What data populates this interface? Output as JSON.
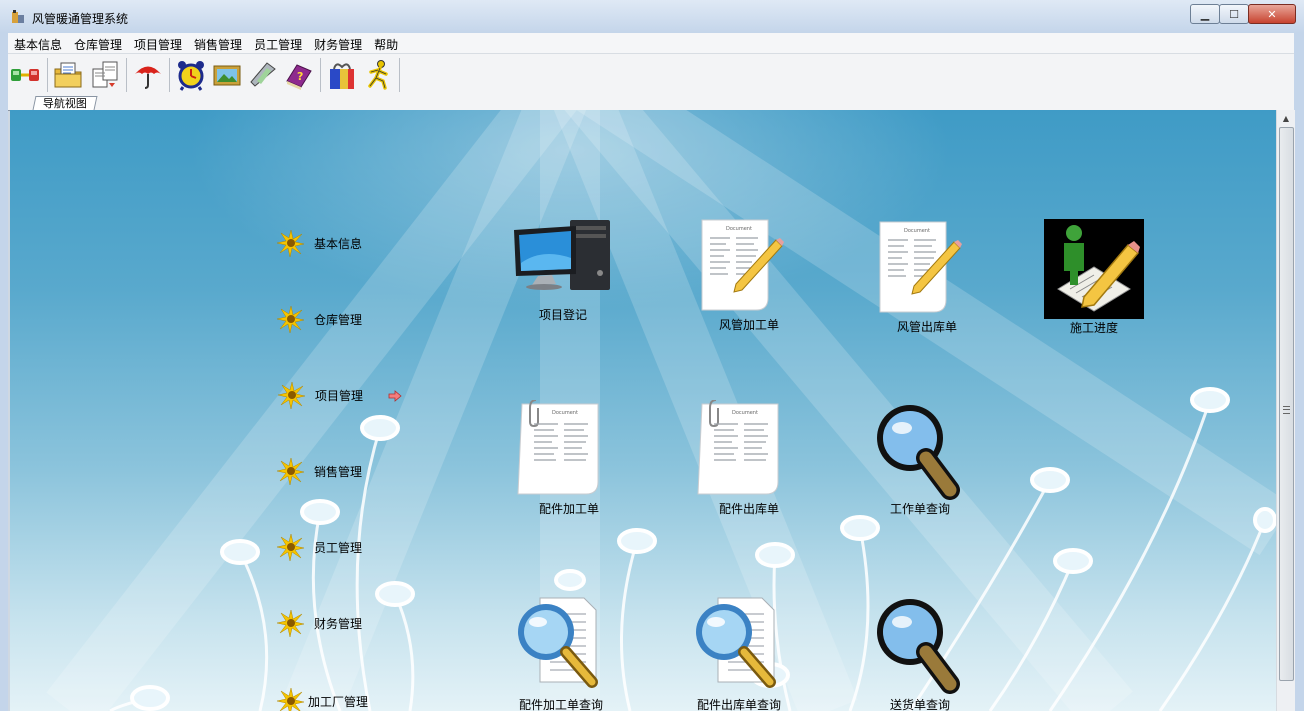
{
  "window": {
    "title": "风管暖通管理系统",
    "app_icon": "app-icon"
  },
  "menu": [
    "基本信息",
    "仓库管理",
    "项目管理",
    "销售管理",
    "员工管理",
    "财务管理",
    "帮助"
  ],
  "toolbar": {
    "groups": [
      [
        "network-icon"
      ],
      [
        "folder-document-icon",
        "document-transfer-icon"
      ],
      [
        "umbrella-icon"
      ],
      [
        "alarm-clock-icon",
        "picture-icon",
        "pda-icon",
        "help-book-icon"
      ],
      [
        "gift-icon",
        "exit-runner-icon"
      ]
    ]
  },
  "tabs": {
    "nav_view": "导航视图"
  },
  "nav": {
    "items": [
      "基本信息",
      "仓库管理",
      "项目管理",
      "销售管理",
      "员工管理",
      "财务管理",
      "加工厂管理"
    ],
    "active_index": 2
  },
  "modules": {
    "project_register": "项目登记",
    "duct_process_order": "风管加工单",
    "duct_outbound_order": "风管出库单",
    "construction_progress": "施工进度",
    "part_process_order": "配件加工单",
    "part_outbound_order": "配件出库单",
    "work_order_query": "工作单查询",
    "part_process_query": "配件加工单查询",
    "part_outbound_query": "配件出库单查询",
    "delivery_order_query": "送货单查询"
  },
  "colors": {
    "accent": "#3f9bc6",
    "flower": "#f5c400"
  }
}
